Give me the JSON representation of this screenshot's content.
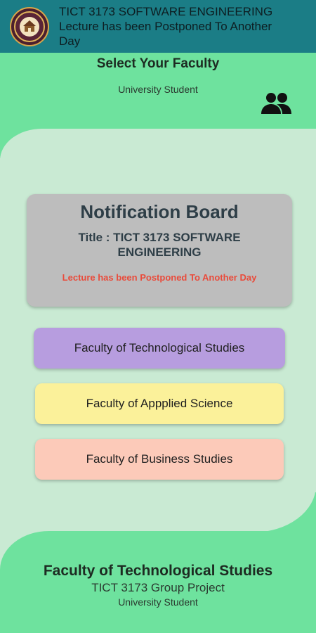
{
  "notification": {
    "line1": "TICT 3173 SOFTWARE ENGINEERING",
    "line2": "Lecture has been Postponed To Another",
    "line3": "Day",
    "logo_icon": "university-crest-icon"
  },
  "header": {
    "title": "Select Your Faculty",
    "subtitle": "University Student",
    "people_icon": "people-icon"
  },
  "board": {
    "title": "Notification Board",
    "subtitle": "Title : TICT 3173 SOFTWARE ENGINEERING",
    "message": "Lecture has been Postponed To Another Day"
  },
  "faculties": [
    {
      "label": "Faculty of Technological Studies",
      "color": "#b79ddf"
    },
    {
      "label": "Faculty of Appplied Science",
      "color": "#fbf19a"
    },
    {
      "label": "Faculty of Business Studies",
      "color": "#fccab9"
    }
  ],
  "footer": {
    "title": "Faculty of Technological Studies",
    "subtitle": "TICT 3173 Group Project",
    "role": "University Student"
  },
  "colors": {
    "accent_green": "#6ee29e",
    "background": "#c9ead3",
    "banner": "#1b7d86",
    "alert_red": "#e94b3b"
  }
}
